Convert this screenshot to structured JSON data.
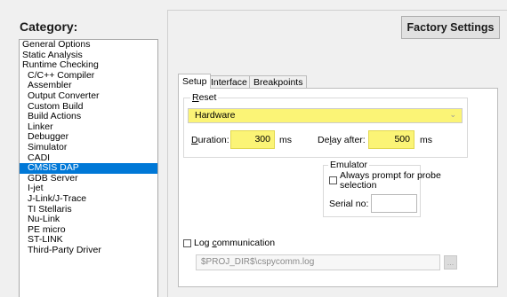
{
  "category": {
    "title": "Category:",
    "items": [
      {
        "label": "General Options",
        "indent": false
      },
      {
        "label": "Static Analysis",
        "indent": false
      },
      {
        "label": "Runtime Checking",
        "indent": false
      },
      {
        "label": "C/C++ Compiler",
        "indent": true
      },
      {
        "label": "Assembler",
        "indent": true
      },
      {
        "label": "Output Converter",
        "indent": true
      },
      {
        "label": "Custom Build",
        "indent": true
      },
      {
        "label": "Build Actions",
        "indent": true
      },
      {
        "label": "Linker",
        "indent": true
      },
      {
        "label": "Debugger",
        "indent": true
      },
      {
        "label": "Simulator",
        "indent": true
      },
      {
        "label": "CADI",
        "indent": true
      },
      {
        "label": "CMSIS DAP",
        "indent": true,
        "selected": true
      },
      {
        "label": "GDB Server",
        "indent": true
      },
      {
        "label": "I-jet",
        "indent": true
      },
      {
        "label": "J-Link/J-Trace",
        "indent": true
      },
      {
        "label": "TI Stellaris",
        "indent": true
      },
      {
        "label": "Nu-Link",
        "indent": true
      },
      {
        "label": "PE micro",
        "indent": true
      },
      {
        "label": "ST-LINK",
        "indent": true
      },
      {
        "label": "Third-Party Driver",
        "indent": true
      }
    ]
  },
  "factory_settings_label": "Factory Settings",
  "tabs": [
    "Setup",
    "Interface",
    "Breakpoints"
  ],
  "reset": {
    "group_label_first": "R",
    "group_label_rest": "eset",
    "selected": "Hardware",
    "duration_label_first": "D",
    "duration_label_rest": "uration:",
    "duration_value": "300",
    "duration_unit": "ms",
    "delay_label_pre": "De",
    "delay_label_key": "l",
    "delay_label_rest": "ay after:",
    "delay_value": "500",
    "delay_unit": "ms"
  },
  "emulator": {
    "group_label": "Emulator",
    "always_prompt_line1": "Always prompt for probe",
    "always_prompt_line2": "selection",
    "serial_label": "Serial no:",
    "serial_value": ""
  },
  "log": {
    "checkbox_label_first": "Log ",
    "checkbox_label_key": "c",
    "checkbox_label_rest": "ommunication",
    "path": "$PROJ_DIR$\\cspycomm.log",
    "browse_label": "..."
  },
  "colors": {
    "highlight": "#fbf476",
    "selection": "#0078d7"
  }
}
